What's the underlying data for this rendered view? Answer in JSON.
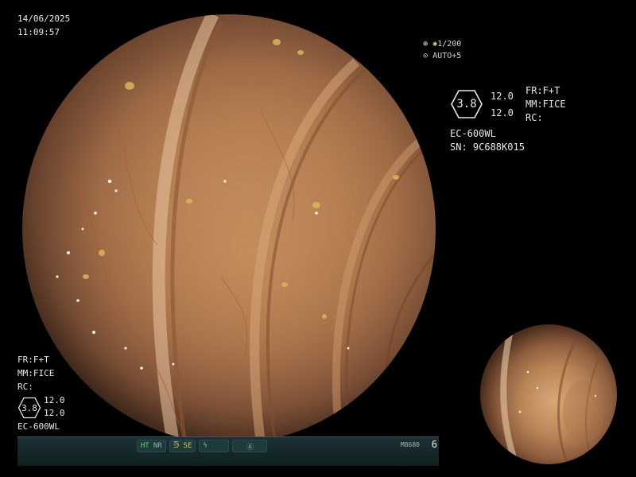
{
  "datetime": {
    "date": "14/06/2025",
    "time": "11:09:57"
  },
  "exposure": {
    "shutter": "1/200",
    "auto": "AUTO+5"
  },
  "right_panel": {
    "badge_value": "3.8",
    "value_top": "12.0",
    "value_bottom": "12.0",
    "scope_model": "EC-600WL",
    "serial": "SN: 9C688K015",
    "fr": "FR:F+T",
    "mm": "MM:FICE",
    "rc": "RC:"
  },
  "left_panel": {
    "fr": "FR:F+T",
    "mm": "MM:FICE",
    "rc": "RC:",
    "badge_value": "3.8",
    "value_top": "12.0",
    "value_bottom": "12.0",
    "scope_model": "EC-600WL"
  },
  "status_bar": {
    "ht": "HT",
    "nr": "NR",
    "se": "SE",
    "code": "M8680",
    "number": "6"
  },
  "icons": {
    "shutter": "iris-icon",
    "auto": "auto-exposure-icon",
    "se": "enhancement-icon",
    "lightning": "flash-icon",
    "record": "record-icon"
  },
  "colors": {
    "status_green": "#5ad06a",
    "status_yellow": "#e2c64a",
    "bar_background": "#1b3034"
  }
}
